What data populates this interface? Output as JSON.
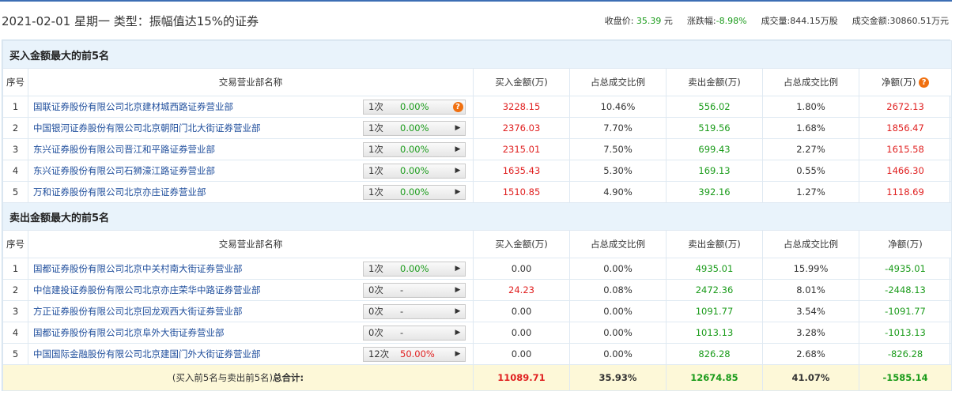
{
  "header": {
    "title": "2021-02-01 星期一 类型：振幅值达15%的证券",
    "close_label": "收盘价:",
    "close_value": "35.39",
    "close_unit": "元",
    "change_label": "涨跌幅:",
    "change_value": "-8.98%",
    "volume_label": "成交量:",
    "volume_value": "844.15万股",
    "amount_label": "成交金额:",
    "amount_value": "30860.51万元"
  },
  "buy_section": {
    "title": "买入金额最大的前5名",
    "columns": [
      "序号",
      "交易营业部名称",
      "买入金额(万)",
      "占总成交比例",
      "卖出金额(万)",
      "占总成交比例",
      "净额(万)"
    ],
    "rows": [
      {
        "no": "1",
        "name": "国联证券股份有限公司北京建材城西路证券营业部",
        "count": "1次",
        "pct": "0.00%",
        "buy": "3228.15",
        "buy_ratio": "10.46%",
        "sell": "556.02",
        "sell_ratio": "1.80%",
        "net": "2672.13"
      },
      {
        "no": "2",
        "name": "中国银河证券股份有限公司北京朝阳门北大街证券营业部",
        "count": "1次",
        "pct": "0.00%",
        "buy": "2376.03",
        "buy_ratio": "7.70%",
        "sell": "519.56",
        "sell_ratio": "1.68%",
        "net": "1856.47"
      },
      {
        "no": "3",
        "name": "东兴证券股份有限公司晋江和平路证券营业部",
        "count": "1次",
        "pct": "0.00%",
        "buy": "2315.01",
        "buy_ratio": "7.50%",
        "sell": "699.43",
        "sell_ratio": "2.27%",
        "net": "1615.58"
      },
      {
        "no": "4",
        "name": "东兴证券股份有限公司石狮濠江路证券营业部",
        "count": "1次",
        "pct": "0.00%",
        "buy": "1635.43",
        "buy_ratio": "5.30%",
        "sell": "169.13",
        "sell_ratio": "0.55%",
        "net": "1466.30"
      },
      {
        "no": "5",
        "name": "万和证券股份有限公司北京亦庄证券营业部",
        "count": "1次",
        "pct": "0.00%",
        "buy": "1510.85",
        "buy_ratio": "4.90%",
        "sell": "392.16",
        "sell_ratio": "1.27%",
        "net": "1118.69"
      }
    ]
  },
  "sell_section": {
    "title": "卖出金额最大的前5名",
    "columns": [
      "序号",
      "交易营业部名称",
      "买入金额(万)",
      "占总成交比例",
      "卖出金额(万)",
      "占总成交比例",
      "净额(万)"
    ],
    "rows": [
      {
        "no": "1",
        "name": "国都证券股份有限公司北京中关村南大街证券营业部",
        "count": "1次",
        "pct": "0.00%",
        "buy": "0.00",
        "buy_ratio": "0.00%",
        "sell": "4935.01",
        "sell_ratio": "15.99%",
        "net": "-4935.01"
      },
      {
        "no": "2",
        "name": "中信建投证券股份有限公司北京亦庄荣华中路证券营业部",
        "count": "0次",
        "pct": "-",
        "buy": "24.23",
        "buy_ratio": "0.08%",
        "sell": "2472.36",
        "sell_ratio": "8.01%",
        "net": "-2448.13"
      },
      {
        "no": "3",
        "name": "方正证券股份有限公司北京回龙观西大街证券营业部",
        "count": "0次",
        "pct": "-",
        "buy": "0.00",
        "buy_ratio": "0.00%",
        "sell": "1091.77",
        "sell_ratio": "3.54%",
        "net": "-1091.77"
      },
      {
        "no": "4",
        "name": "国都证券股份有限公司北京阜外大街证券营业部",
        "count": "0次",
        "pct": "-",
        "buy": "0.00",
        "buy_ratio": "0.00%",
        "sell": "1013.13",
        "sell_ratio": "3.28%",
        "net": "-1013.13"
      },
      {
        "no": "5",
        "name": "中国国际金融股份有限公司北京建国门外大街证券营业部",
        "count": "12次",
        "pct": "50.00%",
        "buy": "0.00",
        "buy_ratio": "0.00%",
        "sell": "826.28",
        "sell_ratio": "2.68%",
        "net": "-826.28"
      }
    ]
  },
  "total": {
    "label_prefix": "(买入前5名与卖出前5名)",
    "label_bold": "总合计:",
    "buy": "11089.71",
    "buy_ratio": "35.93%",
    "sell": "12674.85",
    "sell_ratio": "41.07%",
    "net": "-1585.14"
  },
  "colors": {
    "up": "#e02020",
    "down": "#1a9b1a",
    "link": "#1f4e9c",
    "accent": "#3d6eb4"
  },
  "icons": {
    "help": "question-circle-icon",
    "expand": "play-arrow-icon"
  }
}
